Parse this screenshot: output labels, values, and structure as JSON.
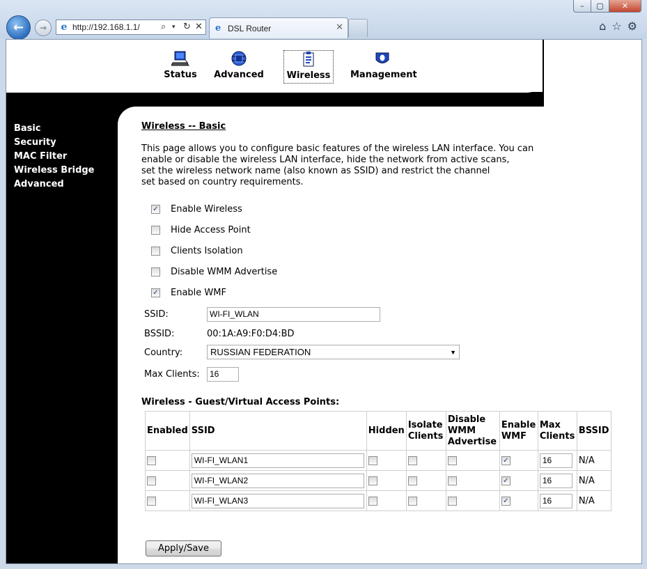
{
  "browser": {
    "url": "http://192.168.1.1/",
    "tab_title": "DSL Router",
    "window_buttons": {
      "minimize": "–",
      "maximize": "▢",
      "close": "✕"
    }
  },
  "top_menu": [
    {
      "label": "Status",
      "icon": "laptop-icon"
    },
    {
      "label": "Advanced",
      "icon": "chip-icon"
    },
    {
      "label": "Wireless",
      "icon": "clipboard-icon",
      "selected": true
    },
    {
      "label": "Management",
      "icon": "shield-icon"
    }
  ],
  "side_menu": [
    "Basic",
    "Security",
    "MAC Filter",
    "Wireless Bridge",
    "Advanced"
  ],
  "page": {
    "title": "Wireless -- Basic",
    "description": [
      "This page allows you to configure basic features of the wireless LAN interface. You can",
      "enable or disable the wireless LAN interface, hide the network from active scans,",
      "set the wireless network name (also known as SSID) and restrict the channel",
      "set based on country requirements."
    ],
    "options": [
      {
        "label": "Enable Wireless",
        "checked": true
      },
      {
        "label": "Hide Access Point",
        "checked": false
      },
      {
        "label": "Clients Isolation",
        "checked": false
      },
      {
        "label": "Disable WMM Advertise",
        "checked": false
      },
      {
        "label": "Enable WMF",
        "checked": true
      }
    ],
    "ssid_label": "SSID:",
    "ssid_value": "WI-FI_WLAN",
    "bssid_label": "BSSID:",
    "bssid_value": "00:1A:A9:F0:D4:BD",
    "country_label": "Country:",
    "country_value": "RUSSIAN FEDERATION",
    "max_clients_label": "Max Clients:",
    "max_clients_value": "16",
    "vap_heading": "Wireless - Guest/Virtual Access Points:",
    "vap_headers": {
      "enabled": "Enabled",
      "ssid": "SSID",
      "hidden": "Hidden",
      "isolate_1": "Isolate",
      "isolate_2": "Clients",
      "wmm_1": "Disable",
      "wmm_2": "WMM",
      "wmm_3": "Advertise",
      "wmf_1": "Enable",
      "wmf_2": "WMF",
      "max_1": "Max",
      "max_2": "Clients",
      "bssid": "BSSID"
    },
    "vap_rows": [
      {
        "enabled": false,
        "ssid": "WI-FI_WLAN1",
        "hidden": false,
        "isolate": false,
        "disable_wmm": false,
        "enable_wmf": true,
        "max_clients": "16",
        "bssid": "N/A"
      },
      {
        "enabled": false,
        "ssid": "WI-FI_WLAN2",
        "hidden": false,
        "isolate": false,
        "disable_wmm": false,
        "enable_wmf": true,
        "max_clients": "16",
        "bssid": "N/A"
      },
      {
        "enabled": false,
        "ssid": "WI-FI_WLAN3",
        "hidden": false,
        "isolate": false,
        "disable_wmm": false,
        "enable_wmf": true,
        "max_clients": "16",
        "bssid": "N/A"
      }
    ],
    "apply_label": "Apply/Save"
  }
}
